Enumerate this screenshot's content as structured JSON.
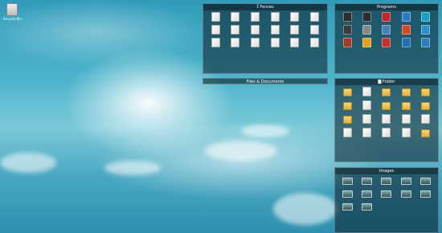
{
  "desktop": {
    "recycle_bin_label": "Recycle Bin"
  },
  "fences": {
    "fences": {
      "title": "Fences",
      "items": [
        "",
        "",
        "",
        "",
        "",
        "",
        "",
        "",
        "",
        "",
        "",
        "",
        "",
        "",
        "",
        "",
        "",
        "",
        "",
        "",
        "",
        "",
        "",
        "",
        "",
        "",
        "",
        "",
        "",
        "",
        "",
        "",
        "",
        "",
        "",
        "",
        "",
        "",
        "",
        "",
        "",
        "",
        "",
        "",
        "",
        "",
        "",
        "",
        "",
        "",
        "",
        "",
        "",
        "",
        "",
        "",
        "",
        "",
        "",
        "",
        "",
        "",
        "",
        "",
        "",
        "",
        "",
        "",
        ""
      ]
    },
    "files_documents": {
      "title": "Files & Documents"
    },
    "programs": {
      "title": "Programs",
      "items": [
        {
          "label": "",
          "color": "#2c2c2c"
        },
        {
          "label": "",
          "color": "#2c2c2c"
        },
        {
          "label": "",
          "color": "#c0262d"
        },
        {
          "label": "",
          "color": "#2e7bbf"
        },
        {
          "label": "",
          "color": "#1aa2c4"
        },
        {
          "label": "",
          "color": "#3a3a3a"
        },
        {
          "label": "",
          "color": "#888888"
        },
        {
          "label": "",
          "color": "#4a7fb0"
        },
        {
          "label": "",
          "color": "#d04a2a"
        },
        {
          "label": "",
          "color": "#2e90c9"
        },
        {
          "label": "",
          "color": "#a33a2a"
        },
        {
          "label": "",
          "color": "#e0a020"
        },
        {
          "label": "",
          "color": "#c53030"
        },
        {
          "label": "",
          "color": "#1f6fb2"
        },
        {
          "label": "",
          "color": "#2a7fc0"
        }
      ]
    },
    "folder": {
      "title": "Folder",
      "items": [
        {
          "label": "",
          "kind": "folder"
        },
        {
          "label": "",
          "kind": "file"
        },
        {
          "label": "",
          "kind": "folder"
        },
        {
          "label": "",
          "kind": "folder"
        },
        {
          "label": "",
          "kind": "folder"
        },
        {
          "label": "",
          "kind": "folder"
        },
        {
          "label": "",
          "kind": "file"
        },
        {
          "label": "",
          "kind": "folder"
        },
        {
          "label": "",
          "kind": "folder"
        },
        {
          "label": "",
          "kind": "folder"
        },
        {
          "label": "",
          "kind": "folder"
        },
        {
          "label": "",
          "kind": "file"
        },
        {
          "label": "",
          "kind": "file"
        },
        {
          "label": "",
          "kind": "file"
        },
        {
          "label": "",
          "kind": "file"
        },
        {
          "label": "",
          "kind": "file"
        },
        {
          "label": "",
          "kind": "file"
        },
        {
          "label": "",
          "kind": "file"
        },
        {
          "label": "",
          "kind": "file"
        },
        {
          "label": "",
          "kind": "folder"
        }
      ]
    },
    "images": {
      "title": "Images",
      "items": [
        "",
        "",
        "",
        "",
        "",
        "",
        "",
        "",
        "",
        "",
        "",
        ""
      ]
    }
  }
}
